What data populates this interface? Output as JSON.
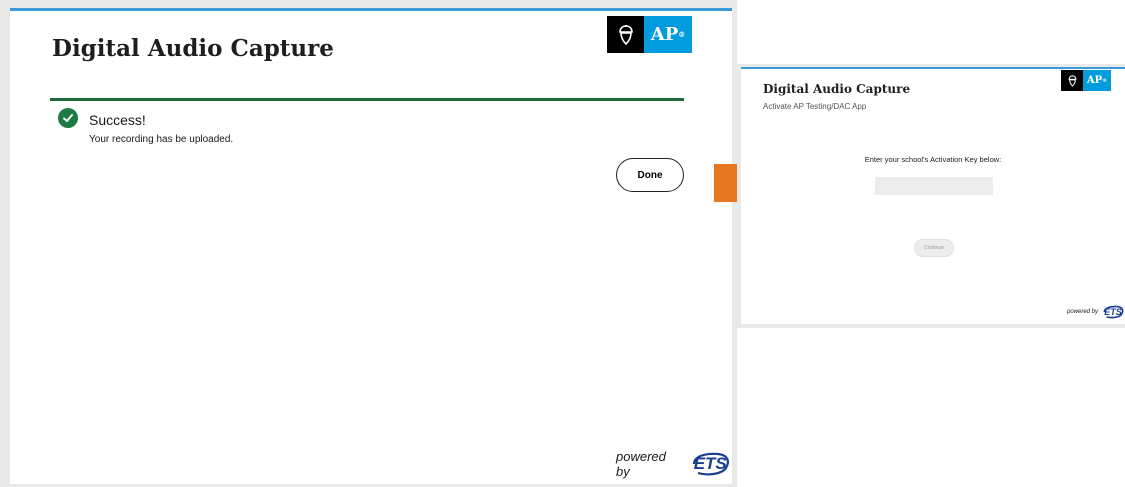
{
  "left_window": {
    "title": "Digital Audio Capture",
    "ap_label": "AP",
    "success_title": "Success!",
    "success_message": "Your recording has be uploaded.",
    "done_label": "Done",
    "powered_by": "powered by",
    "ets_label": "ETS"
  },
  "right_window": {
    "title": "Digital Audio Capture",
    "subtitle": "Activate AP Testing/DAC App",
    "ap_label": "AP",
    "prompt": "Enter your school's Activation Key below:",
    "activation_key_value": "",
    "continue_label": "Continue",
    "powered_by": "powered by",
    "ets_label": "ETS"
  },
  "colors": {
    "accent_blue": "#3a9ad9",
    "ap_blue": "#009cde",
    "success_green": "#1e7a43",
    "divider_green": "#1e6b3c",
    "orange_arrow": "#e87722",
    "ets_blue": "#1a3d8f"
  },
  "icons": {
    "seal": "acorn-seal-icon",
    "check": "check-circle-icon",
    "ets_logo": "ets-logo-icon"
  }
}
